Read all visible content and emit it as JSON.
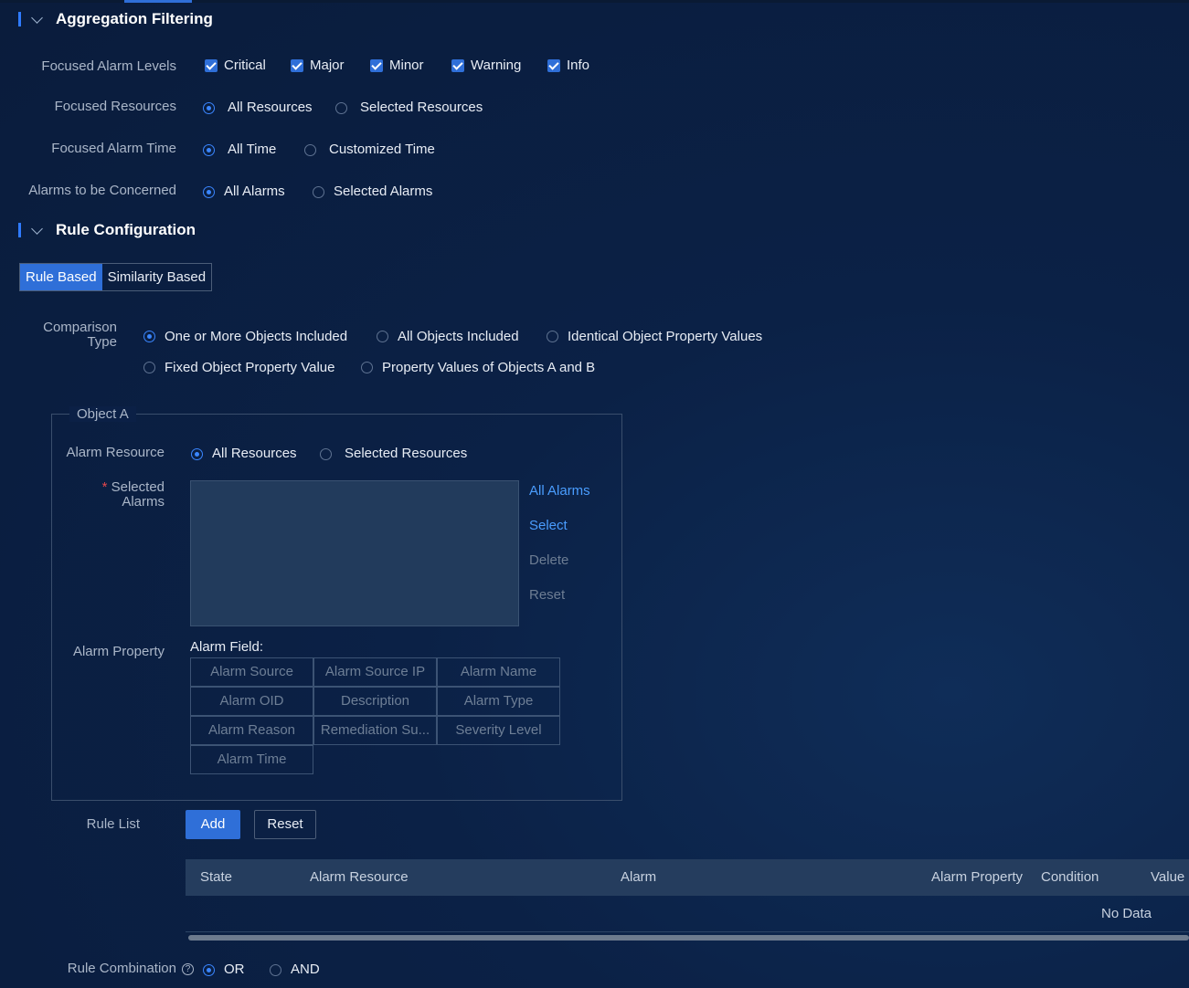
{
  "sections": {
    "aggregation": "Aggregation Filtering",
    "rule_config": "Rule Configuration"
  },
  "levels": {
    "label": "Focused Alarm Levels",
    "items": [
      "Critical",
      "Major",
      "Minor",
      "Warning",
      "Info"
    ]
  },
  "resources": {
    "label": "Focused Resources",
    "options": [
      "All Resources",
      "Selected Resources"
    ]
  },
  "alarm_time": {
    "label": "Focused Alarm Time",
    "options": [
      "All Time",
      "Customized Time"
    ]
  },
  "concerned": {
    "label": "Alarms to be Concerned",
    "options": [
      "All Alarms",
      "Selected Alarms"
    ]
  },
  "mode_tabs": [
    "Rule Based",
    "Similarity Based"
  ],
  "comparison": {
    "label_line1": "Comparison",
    "label_line2": "Type",
    "options": [
      "One or More Objects Included",
      "All Objects Included",
      "Identical Object Property Values",
      "Fixed Object Property Value",
      "Property Values of Objects A and B"
    ]
  },
  "object_a": {
    "legend": "Object A",
    "alarm_resource_label": "Alarm Resource",
    "alarm_resource_options": [
      "All Resources",
      "Selected Resources"
    ],
    "required_mark": "*",
    "selected_alarms_line1": "Selected",
    "selected_alarms_line2": "Alarms",
    "actions": [
      "All Alarms",
      "Select",
      "Delete",
      "Reset"
    ],
    "alarm_property_label": "Alarm Property",
    "alarm_field_label": "Alarm Field:",
    "fields": [
      "Alarm Source",
      "Alarm Source IP",
      "Alarm Name",
      "Alarm OID",
      "Description",
      "Alarm Type",
      "Alarm Reason",
      "Remediation Su...",
      "Severity Level",
      "Alarm Time"
    ]
  },
  "rule_list": {
    "label": "Rule List",
    "add": "Add",
    "reset": "Reset",
    "columns": [
      "State",
      "Alarm Resource",
      "Alarm",
      "Alarm Property",
      "Condition",
      "Value"
    ],
    "empty": "No Data"
  },
  "combination": {
    "label": "Rule Combination",
    "help_glyph": "?",
    "options": [
      "OR",
      "AND"
    ]
  },
  "colors": {
    "accent": "#2f6fd8",
    "background": "#0b2046",
    "link": "#4a9dff"
  }
}
